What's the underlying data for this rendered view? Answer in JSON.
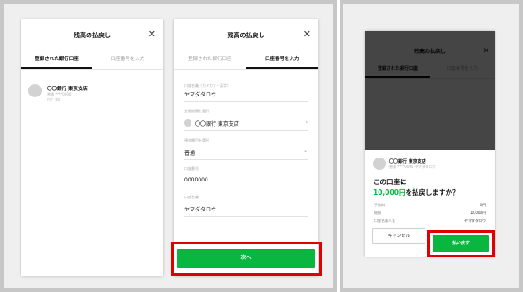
{
  "colors": {
    "accent": "#08b640",
    "highlight": "#e00000",
    "overlay": "#000000"
  },
  "common": {
    "title": "残高の払戻し",
    "tab_registered": "登録された銀行口座",
    "tab_enter": "口座番号を入力",
    "close_icon": "close-icon"
  },
  "screen1": {
    "bank_name": "〇〇銀行 東京支店",
    "bank_detail_1": "普通 ****0000",
    "bank_detail_2": "ﾔﾏﾀﾞ ﾀﾛｳ"
  },
  "screen2": {
    "holder_kana_label": "口座名義（カタカナ・英字）",
    "holder_kana_value": "ヤマダタロウ",
    "bank_label": "金融機関を選択",
    "bank_value": "〇〇銀行 東京支店",
    "account_type_label": "預金種目を選択",
    "account_type_value": "普通",
    "account_number_label": "口座番号",
    "account_number_value": "0000000",
    "holder_label": "口座名義",
    "holder_value": "ヤマダタロウ",
    "next_button": "次へ"
  },
  "screen3": {
    "bank_name": "〇〇銀行 東京支店",
    "bank_detail": "普通 ****0000 ヤマダタロウ",
    "question_line1": "この口座に",
    "amount": "10,000円",
    "question_line2": "を払戻しますか？",
    "fee_label": "手数料",
    "fee_value": "0円",
    "total_label": "総額",
    "total_value": "10,000円",
    "holder_label": "口座名義人名",
    "holder_value": "ヤマダタロウ",
    "cancel_button": "キャンセル",
    "confirm_button": "払い戻す"
  }
}
